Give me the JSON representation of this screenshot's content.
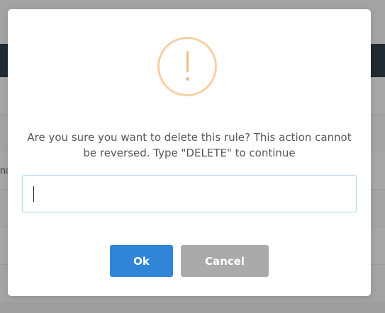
{
  "background": {
    "partial_text": "na"
  },
  "dialog": {
    "message": "Are you sure you want to delete this rule? This action cannot be reversed. Type \"DELETE\" to continue",
    "input_value": "",
    "ok_label": "Ok",
    "cancel_label": "Cancel"
  },
  "colors": {
    "overlay": "#a3a3a3",
    "app_header": "#1f2a33",
    "warning_ring": "#f8cfa3",
    "warning_mark": "#f6bc83",
    "ok_button": "#3085d6",
    "cancel_button": "#aaaaaa",
    "input_border": "#b4dbed"
  },
  "icons": {
    "warning": "exclamation-circle"
  }
}
